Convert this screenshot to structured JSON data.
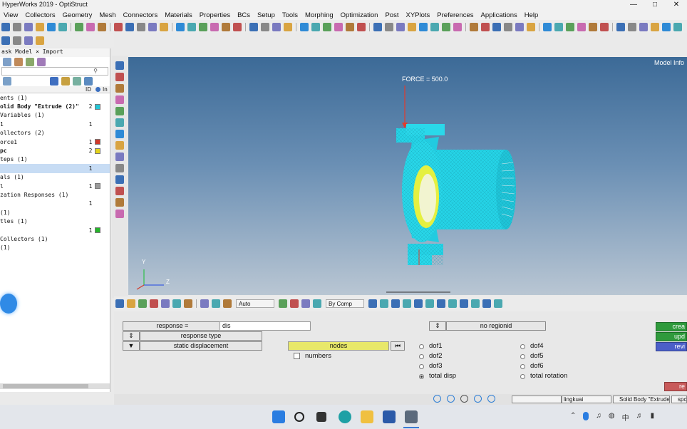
{
  "window": {
    "title": "HyperWorks 2019 - OptiStruct",
    "controls": [
      "—",
      "□",
      "✕"
    ]
  },
  "menubar": [
    "View",
    "Collectors",
    "Geometry",
    "Mesh",
    "Connectors",
    "Materials",
    "Properties",
    "BCs",
    "Setup",
    "Tools",
    "Morphing",
    "Optimization",
    "Post",
    "XYPlots",
    "Preferences",
    "Applications",
    "Help"
  ],
  "colors": {
    "accent_yellow": "#e8e86a",
    "green_button": "#2f9a3c",
    "blue_button": "#4b5fc8",
    "red_button": "#c85a5a",
    "part_cyan": "#25d3e6"
  },
  "browser": {
    "tabs": "ask  Model × Import",
    "columns": {
      "id": "ID",
      "include": "In"
    },
    "rows": [
      {
        "label": "ents (1)"
      },
      {
        "label": "olid Body \"Extrude (2)\"",
        "id": "2",
        "color": "#22c6d6",
        "bold": true
      },
      {
        "label": "Variables (1)"
      },
      {
        "label": "1",
        "id": "1"
      },
      {
        "label": "ollectors (2)"
      },
      {
        "label": "orce1",
        "id": "1",
        "color": "#d23a2a"
      },
      {
        "label": "pc",
        "id": "2",
        "color": "#e3d21a",
        "bold": true
      },
      {
        "label": "teps (1)"
      },
      {
        "label": "",
        "id": "1",
        "selected": true
      },
      {
        "label": "als (1)"
      },
      {
        "label": "l",
        "id": "1",
        "color": "#9a9a9a"
      },
      {
        "label": "zation Responses (1)"
      },
      {
        "label": "",
        "id": "1"
      },
      {
        "label": "(1)"
      },
      {
        "label": "tles (1)"
      },
      {
        "label": "",
        "id": "1",
        "color": "#25b52a"
      },
      {
        "label": "Collectors (1)"
      },
      {
        "label": "(1)"
      }
    ]
  },
  "viewport": {
    "model_info": "Model Info",
    "force_label": "FORCE = 500.0",
    "axes": {
      "y": "Y",
      "z": "Z"
    }
  },
  "vis_toolbar": {
    "auto_select": "Auto",
    "comp_select": "By Comp"
  },
  "panel": {
    "response_label": "response =",
    "response_value": "dis",
    "response_type_label": "response type",
    "response_type_value": "static displacement",
    "region_toggle": "no regionid",
    "nodes_label": "nodes",
    "numbers_label": "numbers",
    "dofs_left": [
      {
        "label": "dof1",
        "checked": false
      },
      {
        "label": "dof2",
        "checked": false
      },
      {
        "label": "dof3",
        "checked": false
      },
      {
        "label": "total disp",
        "checked": true
      }
    ],
    "dofs_right": [
      {
        "label": "dof4",
        "checked": false
      },
      {
        "label": "dof5",
        "checked": false
      },
      {
        "label": "dof6",
        "checked": false
      },
      {
        "label": "total rotation",
        "checked": false
      }
    ],
    "right_buttons": [
      "crea",
      "upd",
      "revi"
    ],
    "return_button": "re"
  },
  "statusbar": {
    "field1": "",
    "field2": "lingkuai",
    "field3": "Solid Body \"Extrude",
    "field4": "spc"
  }
}
